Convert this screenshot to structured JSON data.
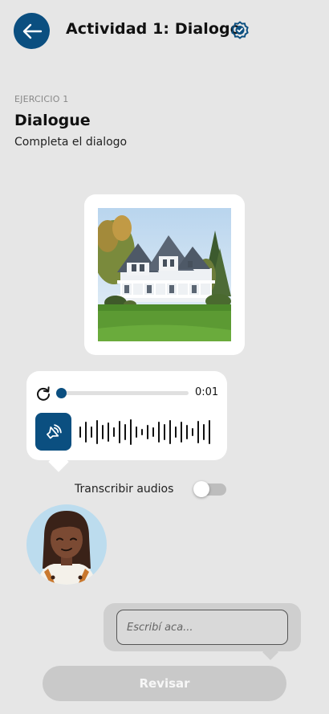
{
  "header": {
    "title": "Actividad 1: Dialogo",
    "back_icon": "arrow-left-icon",
    "status_icon": "verified-check-icon"
  },
  "exercise": {
    "kicker": "EJERCICIO 1",
    "title": "Dialogue",
    "instruction": "Completa el dialogo"
  },
  "image": {
    "subject": "house-photo"
  },
  "audio": {
    "time": "0:01",
    "progress": 0,
    "replay_icon": "replay-icon",
    "speaker_icon": "speaker-icon"
  },
  "transcribe": {
    "label": "Transcribir audios",
    "enabled": false
  },
  "reply": {
    "placeholder": "Escribí aca..."
  },
  "review_button": {
    "label": "Revisar"
  },
  "colors": {
    "accent": "#0b4f80",
    "background": "#e6e6e6",
    "disabled_button": "#c9c9c9"
  }
}
